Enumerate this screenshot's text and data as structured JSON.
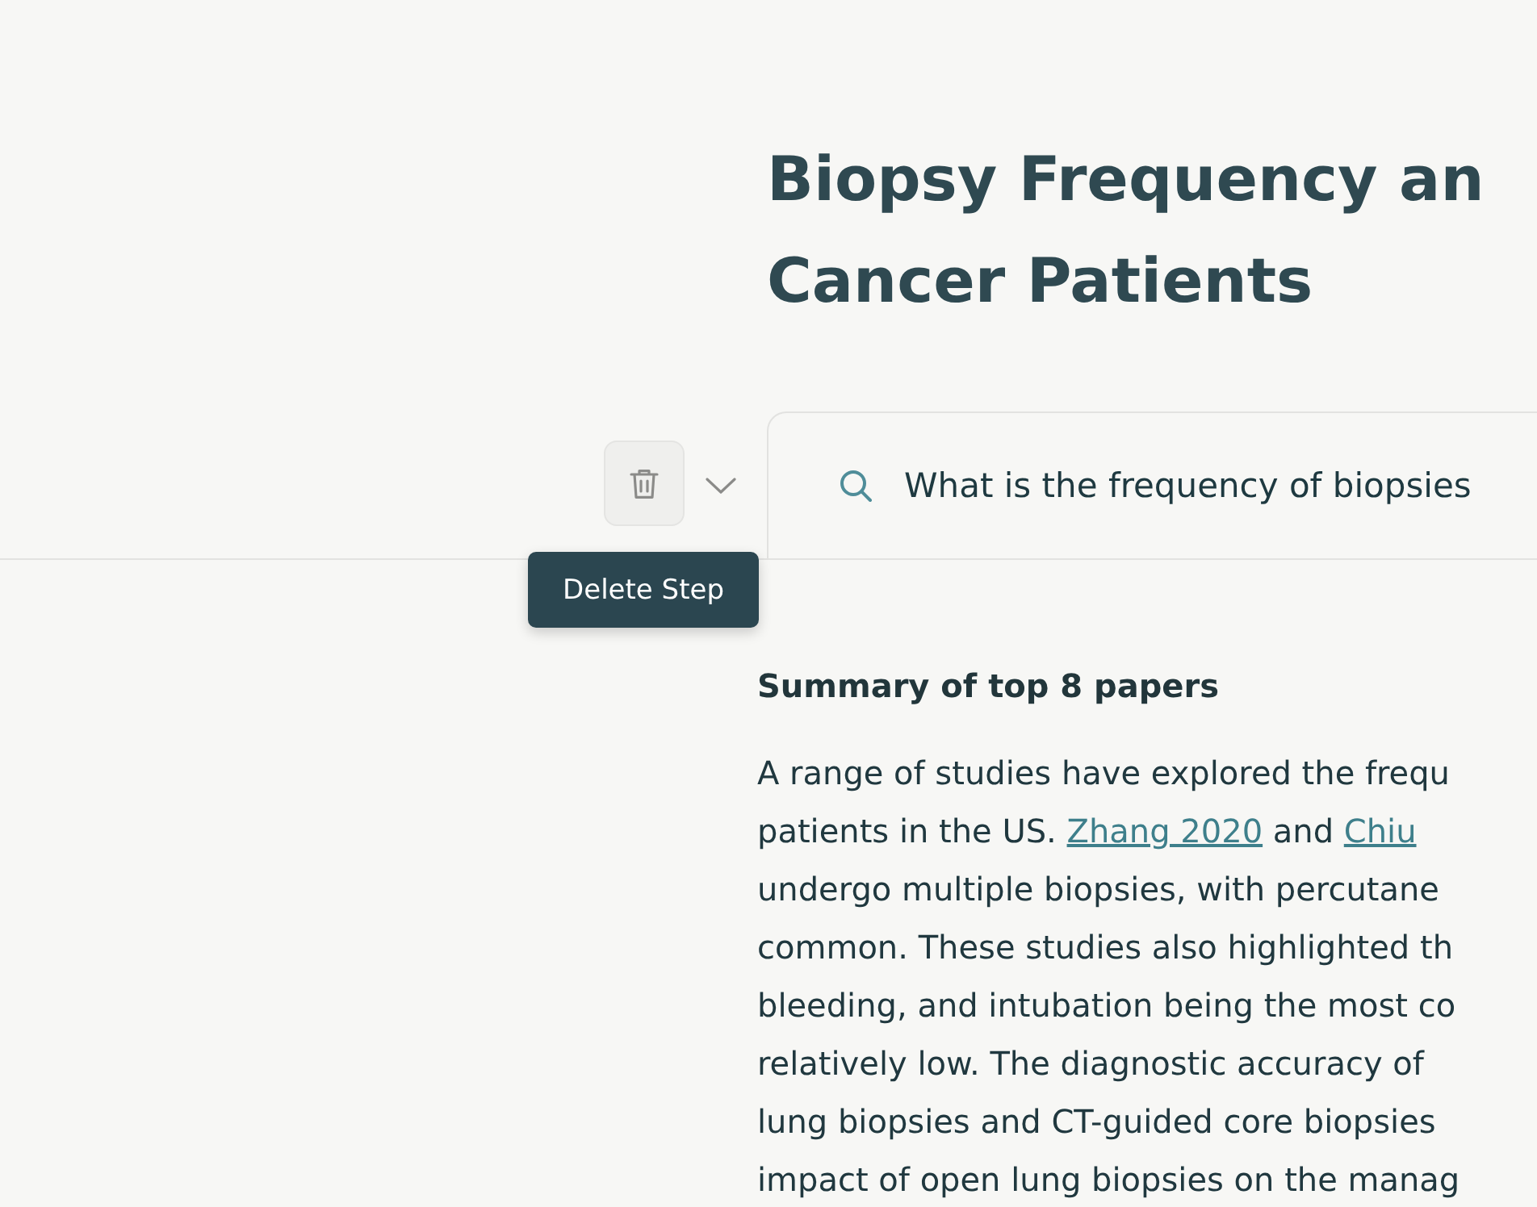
{
  "title": {
    "lines": [
      "Biopsy Frequency an",
      "Cancer Patients"
    ]
  },
  "toolbar": {
    "delete_button": {
      "tooltip": "Delete Step"
    },
    "search": {
      "value": "What is the frequency of biopsies"
    }
  },
  "summary": {
    "heading": "Summary of top 8 papers",
    "lines": [
      [
        {
          "kind": "text",
          "text": "A range of studies have explored the frequ"
        }
      ],
      [
        {
          "kind": "text",
          "text": "patients in the US. "
        },
        {
          "kind": "link",
          "text": "Zhang 2020"
        },
        {
          "kind": "text",
          "text": " and "
        },
        {
          "kind": "link",
          "text": "Chiu"
        }
      ],
      [
        {
          "kind": "text",
          "text": "undergo multiple biopsies, with percutane"
        }
      ],
      [
        {
          "kind": "text",
          "text": "common. These studies also highlighted th"
        }
      ],
      [
        {
          "kind": "text",
          "text": "bleeding, and intubation being the most co"
        }
      ],
      [
        {
          "kind": "text",
          "text": "relatively low. The diagnostic accuracy of"
        }
      ],
      [
        {
          "kind": "text",
          "text": "lung biopsies and CT-guided core biopsies"
        }
      ],
      [
        {
          "kind": "text",
          "text": "impact of open lung biopsies on the manag"
        }
      ]
    ]
  }
}
